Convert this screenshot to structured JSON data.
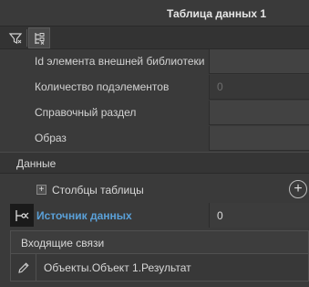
{
  "window": {
    "title": "Таблица данных 1"
  },
  "toolbar": {
    "buttons": [
      {
        "icon": "filter-icon"
      },
      {
        "icon": "tree-structure-icon"
      }
    ]
  },
  "properties": [
    {
      "label": "Id элемента внешней библиотеки",
      "value": ""
    },
    {
      "label": "Количество подэлементов",
      "value": "0"
    },
    {
      "label": "Справочный раздел",
      "value": ""
    },
    {
      "label": "Образ",
      "value": ""
    }
  ],
  "data_section": {
    "label": "Данные",
    "columns": {
      "expander": "+",
      "label": "Столбцы таблицы",
      "add_icon": "+"
    },
    "source": {
      "label": "Источник данных",
      "value": "0"
    }
  },
  "incoming_links": {
    "label": "Входящие связи",
    "items": [
      {
        "label": "Объекты.Объект 1.Результат"
      }
    ]
  },
  "colors": {
    "accent": "#5aa0d8",
    "background": "#3a3a3a"
  }
}
